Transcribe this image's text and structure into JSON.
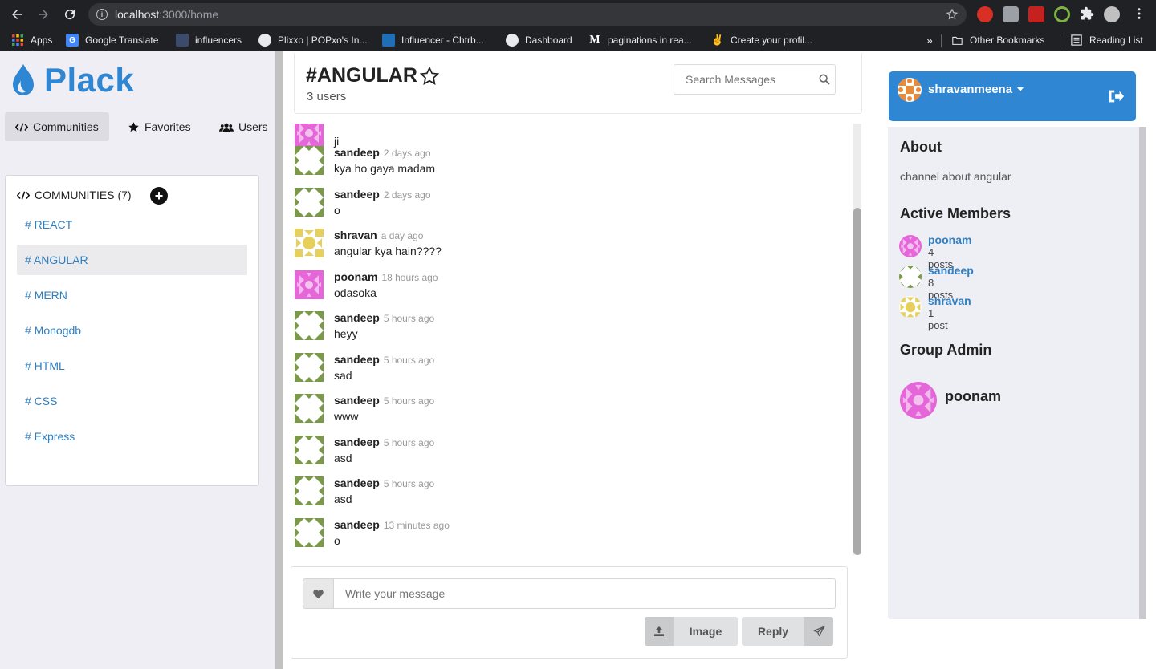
{
  "browser": {
    "url_host": "localhost",
    "url_path": ":3000/home",
    "bookmarks": [
      {
        "label": "Apps",
        "icon": "apps-grid-icon"
      },
      {
        "label": "Google Translate",
        "icon": "translate-icon"
      },
      {
        "label": "influencers",
        "icon": "influencers-icon"
      },
      {
        "label": "Plixxo | POPxo's In...",
        "icon": "globe-icon"
      },
      {
        "label": "Influencer - Chtrb...",
        "icon": "chtrbox-icon"
      },
      {
        "label": "Dashboard",
        "icon": "globe-icon"
      },
      {
        "label": "paginations in rea...",
        "icon": "medium-icon"
      },
      {
        "label": "Create your profil...",
        "icon": "victory-icon"
      },
      {
        "label": "»",
        "icon": "more-chevron-icon"
      },
      {
        "label": "Other Bookmarks",
        "icon": "folder-icon"
      },
      {
        "label": "Reading List",
        "icon": "reading-list-icon"
      }
    ],
    "colors": {
      "chrome_bg": "#202124",
      "omnibox_bg": "#35363a"
    }
  },
  "app": {
    "logo_text": "Plack",
    "tabs": [
      {
        "label": "Communities",
        "icon": "code-icon",
        "active": true
      },
      {
        "label": "Favorites",
        "icon": "star-icon",
        "active": false
      },
      {
        "label": "Users",
        "icon": "users-icon",
        "active": false
      }
    ],
    "communities_header": "COMMUNITIES (7)",
    "add_icon_glyph": "+",
    "communities": [
      "# REACT",
      "# ANGULAR",
      "# MERN",
      "# Monogdb",
      "# HTML",
      "# CSS",
      "# Express"
    ],
    "active_community_index": 1,
    "colors": {
      "brand": "#2f86d3",
      "link": "#2f7fc1",
      "left_bg": "#eeeef4"
    }
  },
  "channel": {
    "title": "#ANGULAR",
    "users": "3 users",
    "search_placeholder": "Search Messages"
  },
  "messages": [
    {
      "author": "",
      "time": "",
      "text": "ji",
      "avatar": "poonam"
    },
    {
      "author": "sandeep",
      "time": "2 days ago",
      "text": "kya ho gaya madam",
      "avatar": "sandeep"
    },
    {
      "author": "sandeep",
      "time": "2 days ago",
      "text": "o",
      "avatar": "sandeep"
    },
    {
      "author": "shravan",
      "time": "a day ago",
      "text": "angular kya hain????",
      "avatar": "shravan"
    },
    {
      "author": "poonam",
      "time": "18 hours ago",
      "text": "odasoka",
      "avatar": "poonam"
    },
    {
      "author": "sandeep",
      "time": "5 hours ago",
      "text": "heyy",
      "avatar": "sandeep"
    },
    {
      "author": "sandeep",
      "time": "5 hours ago",
      "text": "sad",
      "avatar": "sandeep"
    },
    {
      "author": "sandeep",
      "time": "5 hours ago",
      "text": "www",
      "avatar": "sandeep"
    },
    {
      "author": "sandeep",
      "time": "5 hours ago",
      "text": "asd",
      "avatar": "sandeep"
    },
    {
      "author": "sandeep",
      "time": "5 hours ago",
      "text": "asd",
      "avatar": "sandeep"
    },
    {
      "author": "sandeep",
      "time": "13 minutes ago",
      "text": "o",
      "avatar": "sandeep"
    }
  ],
  "compose": {
    "placeholder": "Write your message",
    "image_label": "Image",
    "reply_label": "Reply"
  },
  "sidebar": {
    "username": "shravanmeena",
    "about_heading": "About",
    "about_text": "channel about angular",
    "members_heading": "Active Members",
    "members": [
      {
        "name": "poonam",
        "posts": "4 posts",
        "avatar": "poonam"
      },
      {
        "name": "sandeep",
        "posts": "8 posts",
        "avatar": "sandeep"
      },
      {
        "name": "shravan",
        "posts": "1 post",
        "avatar": "shravan"
      }
    ],
    "admin_heading": "Group Admin",
    "admin_name": "poonam"
  },
  "avatar_colors": {
    "poonam": "#e466d8",
    "sandeep": "#7a9a4a",
    "shravan": "#e6cf5a",
    "shravanmeena": "#e88a3a"
  }
}
